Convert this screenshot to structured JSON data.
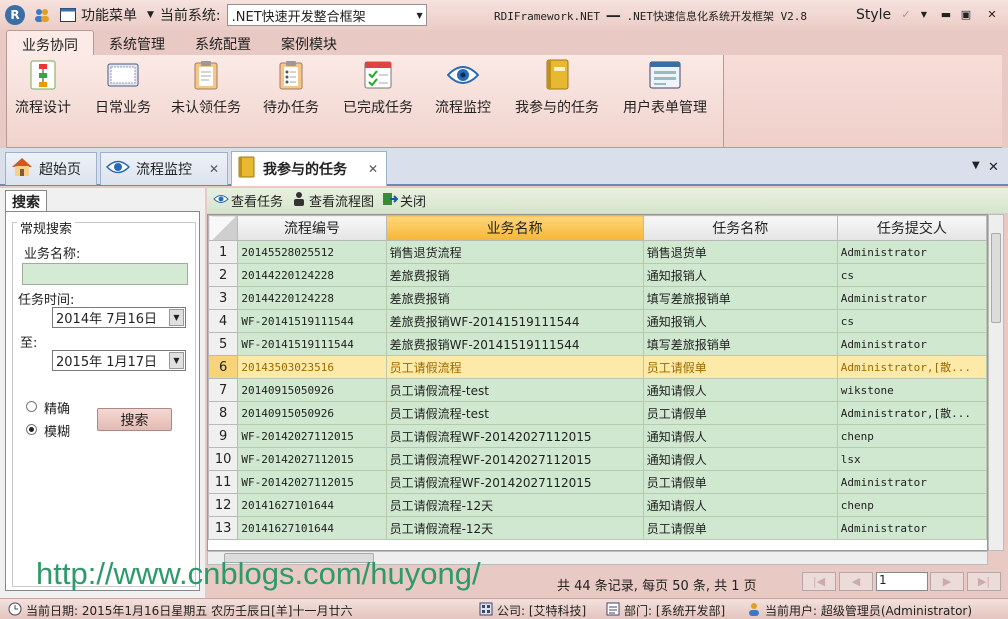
{
  "titlebar": {
    "logo": "R",
    "menu_label": "功能菜单",
    "current_system_label": "当前系统:",
    "current_system_value": ".NET快速开发整合框架",
    "app_title": "RDIFramework.NET ━━ .NET快速信息化系统开发框架 V2.8",
    "style_label": "Style"
  },
  "ribbon_tabs": [
    "业务协同",
    "系统管理",
    "系统配置",
    "案例模块"
  ],
  "ribbon_buttons": [
    {
      "label": "流程设计",
      "icon": "workflow-design-icon"
    },
    {
      "label": "日常业务",
      "icon": "daily-business-icon"
    },
    {
      "label": "未认领任务",
      "icon": "unclaimed-task-icon"
    },
    {
      "label": "待办任务",
      "icon": "todo-task-icon"
    },
    {
      "label": "已完成任务",
      "icon": "completed-task-icon"
    },
    {
      "label": "流程监控",
      "icon": "eye-icon"
    },
    {
      "label": "我参与的任务",
      "icon": "notebook-icon"
    },
    {
      "label": "用户表单管理",
      "icon": "form-window-icon"
    }
  ],
  "doc_tabs": [
    {
      "label": "超始页",
      "icon": "home-icon"
    },
    {
      "label": "流程监控",
      "icon": "eye-icon"
    },
    {
      "label": "我参与的任务",
      "icon": "notebook-icon"
    }
  ],
  "search": {
    "tab_label": "搜索",
    "group_label": "常规搜索",
    "business_name_label": "业务名称:",
    "business_name_value": "",
    "task_time_label": "任务时间:",
    "date_from": "2014年  7月16日",
    "to_label": "至:",
    "date_to": "2015年  1月17日",
    "exact_label": "精确",
    "fuzzy_label": "模糊",
    "search_button": "搜索"
  },
  "toolbar": {
    "view_task": "查看任务",
    "view_flowchart": "查看流程图",
    "close": "关闭"
  },
  "grid": {
    "columns": [
      "流程编号",
      "业务名称",
      "任务名称",
      "任务提交人"
    ],
    "selected_row": 6,
    "rows": [
      [
        "1",
        "20145528025512",
        "销售退货流程",
        "销售退货单",
        "Administrator"
      ],
      [
        "2",
        "20144220124228",
        "差旅费报销",
        "通知报销人",
        "cs"
      ],
      [
        "3",
        "20144220124228",
        "差旅费报销",
        "填写差旅报销单",
        "Administrator"
      ],
      [
        "4",
        "WF-20141519111544",
        "差旅费报销WF-20141519111544",
        "通知报销人",
        "cs"
      ],
      [
        "5",
        "WF-20141519111544",
        "差旅费报销WF-20141519111544",
        "填写差旅报销单",
        "Administrator"
      ],
      [
        "6",
        "20143503023516",
        "员工请假流程",
        "员工请假单",
        "Administrator,[散..."
      ],
      [
        "7",
        "20140915050926",
        "员工请假流程-test",
        "通知请假人",
        "wikstone"
      ],
      [
        "8",
        "20140915050926",
        "员工请假流程-test",
        "员工请假单",
        "Administrator,[散..."
      ],
      [
        "9",
        "WF-20142027112015",
        "员工请假流程WF-20142027112015",
        "通知请假人",
        "chenp"
      ],
      [
        "10",
        "WF-20142027112015",
        "员工请假流程WF-20142027112015",
        "通知请假人",
        "lsx"
      ],
      [
        "11",
        "WF-20142027112015",
        "员工请假流程WF-20142027112015",
        "员工请假单",
        "Administrator"
      ],
      [
        "12",
        "20141627101644",
        "员工请假流程-12天",
        "通知请假人",
        "chenp"
      ],
      [
        "13",
        "20141627101644",
        "员工请假流程-12天",
        "员工请假单",
        "Administrator"
      ]
    ]
  },
  "watermark": "http://www.cnblogs.com/huyong/",
  "pager": {
    "summary": "共 44 条记录, 每页 50 条, 共 1 页",
    "page_value": "1"
  },
  "statusbar": {
    "date": "当前日期: 2015年1月16日星期五 农历壬辰日[羊]十一月廿六",
    "company": "公司: [艾特科技]",
    "department": "部门: [系统开发部]",
    "user": "当前用户: 超级管理员(Administrator)"
  },
  "colors": {
    "accent": "#f5b637",
    "grid_row": "#cfe8cf",
    "selected_row": "#fde9a8",
    "ribbon": "#f1d3cd"
  }
}
